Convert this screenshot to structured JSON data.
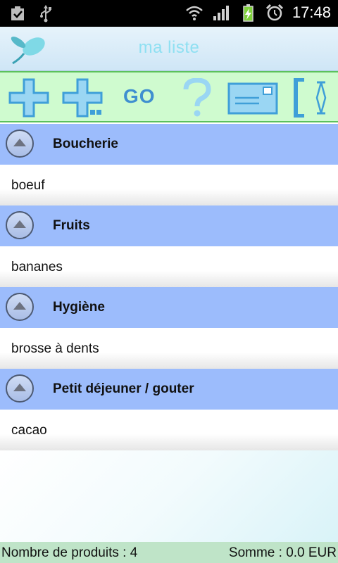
{
  "status_bar": {
    "time": "17:48",
    "icons": [
      "checkbox-notification-icon",
      "usb-icon",
      "wifi-icon",
      "signal-icon",
      "battery-charging-icon",
      "alarm-icon"
    ]
  },
  "app": {
    "title": "ma liste",
    "logo_icon": "leaf-logo-icon"
  },
  "toolbar": {
    "go_label": "GO",
    "buttons": [
      "add-icon",
      "add-multiple-icon",
      "go",
      "help-icon",
      "message-icon",
      "expand-collapse-icon"
    ],
    "colors": {
      "background": "#cffbcf",
      "border": "#5cc15c",
      "icon": "#3f9fd8"
    }
  },
  "categories": [
    {
      "label": "Boucherie",
      "items": [
        "boeuf"
      ]
    },
    {
      "label": "Fruits",
      "items": [
        "bananes"
      ]
    },
    {
      "label": "Hygiène",
      "items": [
        "brosse à dents"
      ]
    },
    {
      "label": "Petit déjeuner / gouter",
      "items": [
        "cacao"
      ]
    }
  ],
  "footer": {
    "count_text": "Nombre de produits : 4",
    "sum_text": "Somme : 0.0 EUR"
  },
  "colors": {
    "category_header": "#9cbcfc",
    "title_text": "#8fe0f2",
    "footer_bg": "#bfe4c8"
  }
}
